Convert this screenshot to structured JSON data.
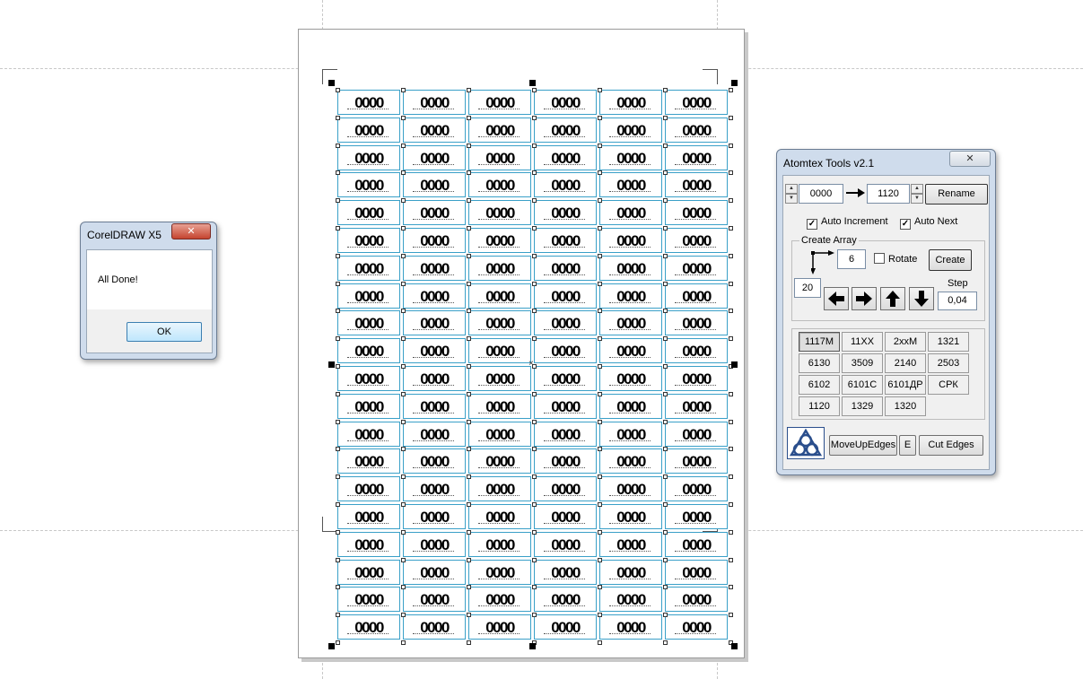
{
  "document": {
    "label_text": "0000",
    "columns": 6,
    "rows": 20
  },
  "corel_dialog": {
    "title": "CorelDRAW X5",
    "close_glyph": "✕",
    "message": "All Done!",
    "ok_label": "OK"
  },
  "atomtex": {
    "title": "Atomtex Tools v2.1",
    "close_glyph": "✕",
    "start_number": "0000",
    "end_number": "1120",
    "rename_label": "Rename",
    "auto_increment_label": "Auto Increment",
    "auto_increment_checked": true,
    "auto_next_label": "Auto Next",
    "auto_next_checked": true,
    "create_array_label": "Create Array",
    "columns_value": "6",
    "rows_value": "20",
    "rotate_label": "Rotate",
    "rotate_checked": false,
    "create_label": "Create",
    "step_label": "Step",
    "step_value": "0,04",
    "presets": [
      "1117M",
      "11XX",
      "2xxM",
      "1321",
      "6130",
      "3509",
      "2140",
      "2503",
      "6102",
      "6101C",
      "6101ДР",
      "СРК",
      "1120",
      "1329",
      "1320"
    ],
    "active_preset": "1117M",
    "move_up_edges_label": "MoveUpEdges",
    "e_label": "E",
    "cut_edges_label": "Cut Edges",
    "colors": {
      "logo_blue": "#2a4e8c",
      "label_border": "#3aa0c8"
    }
  }
}
